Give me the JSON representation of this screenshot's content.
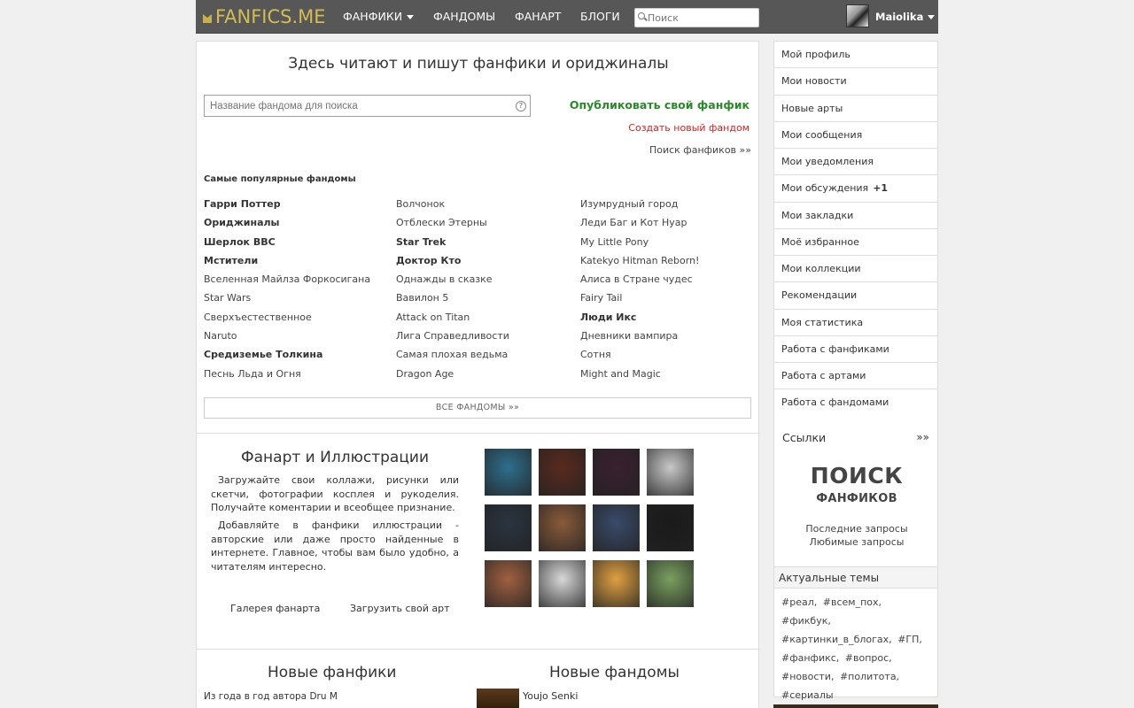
{
  "header": {
    "logo": "FANFICS.ME",
    "nav": [
      {
        "label": "ФАНФИКИ",
        "caret": true
      },
      {
        "label": "ФАНДОМЫ",
        "caret": false
      },
      {
        "label": "ФАНАРТ",
        "caret": false
      },
      {
        "label": "БЛОГИ",
        "caret": false
      }
    ],
    "search_placeholder": "Поиск",
    "username": "Maiolika"
  },
  "main": {
    "title": "Здесь читают и пишут фанфики и ориджиналы",
    "fandom_search_placeholder": "Название фандома для поиска",
    "help": "?",
    "publish": "Опубликовать свой фанфик",
    "create_fandom": "Создать новый фандом",
    "search_fics": "Поиск фанфиков »»",
    "popular_title": "Самые популярные фандомы",
    "columns": [
      [
        {
          "name": "Гарри Поттер",
          "bold": true
        },
        {
          "name": "Ориджиналы",
          "bold": true
        },
        {
          "name": "Шерлок BBC",
          "bold": true
        },
        {
          "name": "Мстители",
          "bold": true
        },
        {
          "name": "Вселенная Майлза Форкосигана",
          "bold": false
        },
        {
          "name": "Star Wars",
          "bold": false
        },
        {
          "name": "Сверхъестественное",
          "bold": false
        },
        {
          "name": "Naruto",
          "bold": false
        },
        {
          "name": "Средиземье Толкина",
          "bold": true
        },
        {
          "name": "Песнь Льда и Огня",
          "bold": false
        }
      ],
      [
        {
          "name": "Волчонок",
          "bold": false
        },
        {
          "name": "Отблески Этерны",
          "bold": false
        },
        {
          "name": "Star Trek",
          "bold": true
        },
        {
          "name": "Доктор Кто",
          "bold": true
        },
        {
          "name": "Однажды в сказке",
          "bold": false
        },
        {
          "name": "Вавилон 5",
          "bold": false
        },
        {
          "name": "Attack on Titan",
          "bold": false
        },
        {
          "name": "Лига Справедливости",
          "bold": false
        },
        {
          "name": "Самая плохая ведьма",
          "bold": false
        },
        {
          "name": "Dragon Age",
          "bold": false
        }
      ],
      [
        {
          "name": "Изумрудный город",
          "bold": false
        },
        {
          "name": "Леди Баг и Кот Нуар",
          "bold": false
        },
        {
          "name": "My Little Pony",
          "bold": false
        },
        {
          "name": "Katekyo Hitman Reborn!",
          "bold": false
        },
        {
          "name": "Алиса в Стране чудес",
          "bold": false
        },
        {
          "name": "Fairy Tail",
          "bold": false
        },
        {
          "name": "Люди Икс",
          "bold": true
        },
        {
          "name": "Дневники вампира",
          "bold": false
        },
        {
          "name": "Сотня",
          "bold": false
        },
        {
          "name": "Might and Magic",
          "bold": false
        }
      ]
    ],
    "all_fandoms": "ВСЕ ФАНДОМЫ »»",
    "art": {
      "title": "Фанарт и Иллюстрации",
      "p1": "Загружайте свои коллажи, рисунки или скетчи, фотографии косплея и рукоделия. Получайте коментарии и всеобщее признание.",
      "p2": "Добавляйте в фанфики иллюстрации - авторские или даже просто найденные в интернете. Главное, чтобы вам было удобно, а читателям интересно.",
      "gallery": "Галерея фанарта",
      "upload": "Загрузить свой арт",
      "thumb_colors": [
        [
          "#2e6f8e",
          "#5a2a1e",
          "#3a2030",
          "#c8c8c8"
        ],
        [
          "#2a3440",
          "#8a5a3a",
          "#3a4a6a",
          "#1a1a1a"
        ],
        [
          "#a06040",
          "#d8d8d8",
          "#e0a040",
          "#7aa060"
        ]
      ]
    },
    "new_fics_title": "Новые фанфики",
    "new_fics_line_a": "Из года в год",
    "new_fics_line_b": "автора",
    "new_fics_line_c": "Dru M",
    "new_fandoms_title": "Новые фандомы",
    "new_fandom_name": "Youjo Senki"
  },
  "sidebar": {
    "items": [
      {
        "label": "Мой профиль",
        "badge": ""
      },
      {
        "label": "Мои новости",
        "badge": ""
      },
      {
        "label": "Новые арты",
        "badge": ""
      },
      {
        "label": "Мои сообщения",
        "badge": ""
      },
      {
        "label": "Мои уведомления",
        "badge": ""
      },
      {
        "label": "Мои обсуждения",
        "badge": "+1"
      },
      {
        "label": "Мои закладки",
        "badge": ""
      },
      {
        "label": "Моё избранное",
        "badge": ""
      },
      {
        "label": "Мои коллекции",
        "badge": ""
      },
      {
        "label": "Рекомендации",
        "badge": ""
      },
      {
        "label": "Моя статистика",
        "badge": ""
      },
      {
        "label": "Работа с фанфиками",
        "badge": ""
      },
      {
        "label": "Работа с артами",
        "badge": ""
      },
      {
        "label": "Работа с фандомами",
        "badge": ""
      }
    ],
    "links_title": "Ссылки",
    "links_more": "»»",
    "poisk_big": "ПОИСК",
    "poisk_small": "ФАНФИКОВ",
    "last_queries": "Последние запросы",
    "fav_queries": "Любимые запросы",
    "topics_title": "Актуальные темы",
    "tags": [
      "#реал,",
      "#всем_пох,",
      "#фикбук,",
      "#картинки_в_блогах,",
      "#ГП,",
      "#фанфикс,",
      "#вопрос,",
      "#новости,",
      "#политота,",
      "#сериалы"
    ]
  }
}
